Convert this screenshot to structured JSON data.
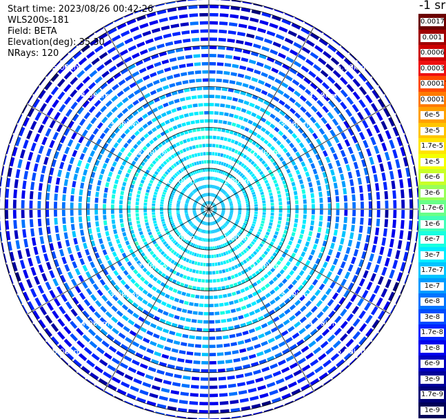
{
  "header": {
    "start_time": "Start time: 2023/08/26 00:42:26",
    "device": "WLS200s-181",
    "field": "Field: BETA",
    "elevation": "Elevation(deg): 35.30",
    "nrays": "NRays: 120"
  },
  "colorbar": {
    "title": "-1 sr",
    "ticks": [
      "0.0017",
      "0.001",
      "0.0006",
      "0.0003",
      "0.00017",
      "0.0001",
      "6e-5",
      "3e-5",
      "1.7e-5",
      "1e-5",
      "6e-6",
      "3e-6",
      "1.7e-6",
      "1e-6",
      "6e-7",
      "3e-7",
      "1.7e-7",
      "1e-7",
      "6e-8",
      "3e-8",
      "1.7e-8",
      "1e-8",
      "6e-9",
      "3e-9",
      "1.7e-9",
      "1e-9"
    ],
    "colors": [
      "#6b0000",
      "#a00000",
      "#cc0000",
      "#ee1010",
      "#ff4a00",
      "#ff7a00",
      "#ffa000",
      "#ffc400",
      "#ffe400",
      "#f4ff00",
      "#c8ff28",
      "#98ff58",
      "#68ff88",
      "#40ffb8",
      "#18ffe0",
      "#00ecff",
      "#00c4ff",
      "#009cff",
      "#0074ff",
      "#004cff",
      "#0024ff",
      "#0000ee",
      "#0000c0",
      "#00009a",
      "#000078",
      "#000058"
    ]
  },
  "chart_data": {
    "type": "heatmap",
    "subtype": "polar-ppi",
    "n_rays": 120,
    "range_rings_km": [
      1,
      2,
      3,
      4,
      5
    ],
    "ring_label_suffix": "km",
    "ring_labels": [
      "1.00km",
      "2.00km",
      "3.00km",
      "4.00km",
      "5.00km"
    ],
    "max_range_km": 5.15,
    "spoke_count": 12,
    "color_scale": "log",
    "value_range": [
      1e-09,
      0.0017
    ],
    "unit": "-1 sr",
    "field": "BETA",
    "grid": true,
    "radial_profile": [
      {
        "range_km": 0.5,
        "beta": 2e-07
      },
      {
        "range_km": 1.0,
        "beta": 3e-07
      },
      {
        "range_km": 1.5,
        "beta": 3e-07
      },
      {
        "range_km": 2.0,
        "beta": 3e-07
      },
      {
        "range_km": 2.5,
        "beta": 1.7e-07
      },
      {
        "range_km": 3.0,
        "beta": 1e-07
      },
      {
        "range_km": 3.5,
        "beta": 6e-08
      },
      {
        "range_km": 4.0,
        "beta": 3e-08
      },
      {
        "range_km": 4.5,
        "beta": 1.7e-08
      },
      {
        "range_km": 5.0,
        "beta": 1e-08
      }
    ]
  }
}
